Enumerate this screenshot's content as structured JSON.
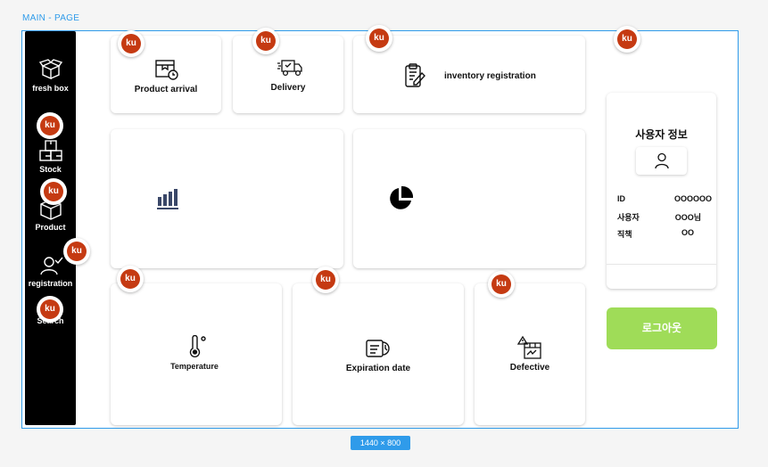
{
  "frame": {
    "label": "MAIN - PAGE",
    "size_badge": "1440 × 800"
  },
  "sidebar": {
    "items": [
      {
        "label": "fresh box",
        "icon": "box-icon"
      },
      {
        "label": "Stock",
        "icon": "stock-boxes-icon"
      },
      {
        "label": "Product",
        "icon": "product-box-icon"
      },
      {
        "label": "registration",
        "icon": "user-check-icon"
      },
      {
        "label": "Search",
        "icon": "search-bubble-icon"
      }
    ]
  },
  "cards": {
    "product_arrival": "Product arrival",
    "delivery": "Delivery",
    "inventory": "inventory registration",
    "temperature": "Temperature",
    "expiration": "Expiration date",
    "defective": "Defective"
  },
  "user_info": {
    "title": "사용자 정보",
    "id_label": "ID",
    "id_value": "OOOOOO",
    "user_label": "사용자",
    "user_value": "OOO님",
    "position_label": "직책",
    "position_value": "OO"
  },
  "logout": "로그아웃",
  "comment_badge": "ku",
  "colors": {
    "accent": "#2f9bea",
    "logout": "#9fdc58",
    "sidebar": "#000000",
    "badge": "#c53a12"
  }
}
